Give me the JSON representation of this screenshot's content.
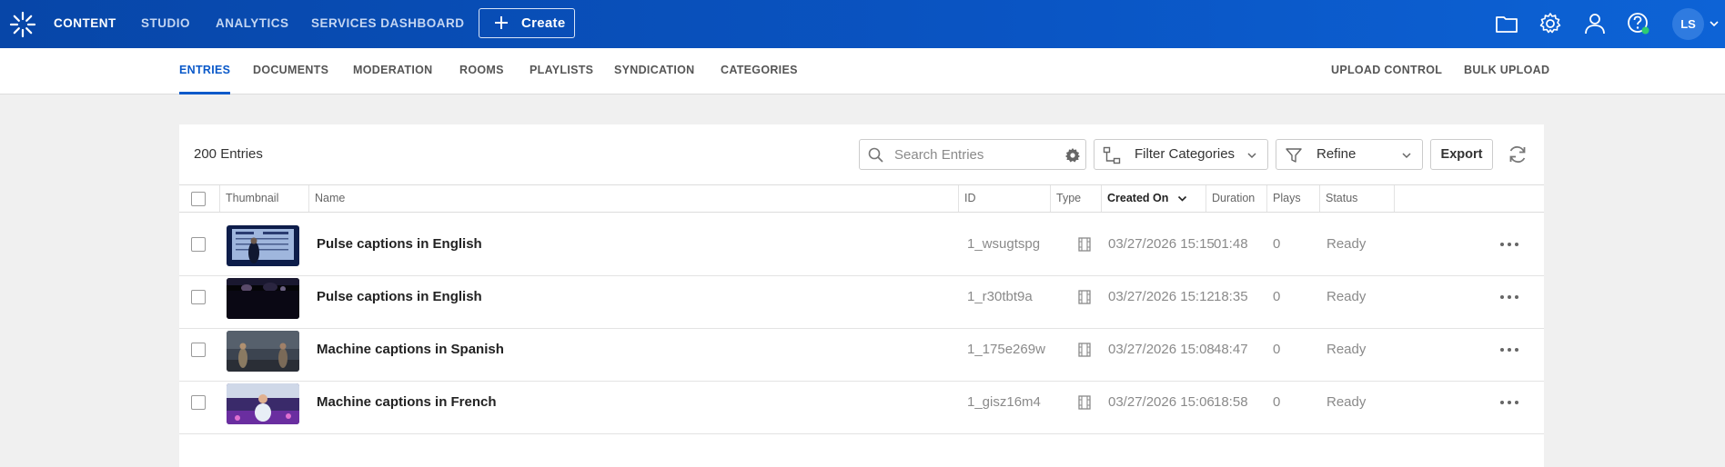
{
  "topbar": {
    "nav": [
      {
        "label": "CONTENT",
        "active": true
      },
      {
        "label": "STUDIO",
        "active": false
      },
      {
        "label": "ANALYTICS",
        "active": false
      },
      {
        "label": "SERVICES DASHBOARD",
        "active": false
      }
    ],
    "create_label": "Create",
    "icons": [
      "folder-icon",
      "gear-icon",
      "user-icon",
      "help-icon"
    ],
    "avatar_initials": "LS"
  },
  "subnav": {
    "left": [
      {
        "label": "ENTRIES",
        "active": true
      },
      {
        "label": "DOCUMENTS",
        "active": false
      },
      {
        "label": "MODERATION",
        "active": false
      },
      {
        "label": "ROOMS",
        "active": false
      },
      {
        "label": "PLAYLISTS",
        "active": false
      },
      {
        "label": "SYNDICATION",
        "active": false
      },
      {
        "label": "CATEGORIES",
        "active": false
      }
    ],
    "right": [
      {
        "label": "UPLOAD CONTROL"
      },
      {
        "label": "BULK UPLOAD"
      }
    ]
  },
  "toolbar": {
    "entries_count": "200 Entries",
    "search_placeholder": "Search Entries",
    "filter_categories_label": "Filter Categories",
    "refine_label": "Refine",
    "export_label": "Export"
  },
  "table": {
    "columns": {
      "thumbnail": "Thumbnail",
      "name": "Name",
      "id": "ID",
      "type": "Type",
      "created_on": "Created On",
      "duration": "Duration",
      "plays": "Plays",
      "status": "Status"
    },
    "rows": [
      {
        "name": "Pulse captions in English",
        "id": "1_wsugtspg",
        "created_on": "03/27/2026 15:15",
        "duration": "01:48",
        "plays": "0",
        "status": "Ready"
      },
      {
        "name": "Pulse captions in English",
        "id": "1_r30tbt9a",
        "created_on": "03/27/2026 15:12",
        "duration": "18:35",
        "plays": "0",
        "status": "Ready"
      },
      {
        "name": "Machine captions in Spanish",
        "id": "1_175e269w",
        "created_on": "03/27/2026 15:08",
        "duration": "48:47",
        "plays": "0",
        "status": "Ready"
      },
      {
        "name": "Machine captions in French",
        "id": "1_gisz16m4",
        "created_on": "03/27/2026 15:06",
        "duration": "18:58",
        "plays": "0",
        "status": "Ready"
      }
    ]
  },
  "colors": {
    "topbar": "#0a55c4",
    "accent": "#0a59c9",
    "page_bg": "#f0f0f0"
  }
}
